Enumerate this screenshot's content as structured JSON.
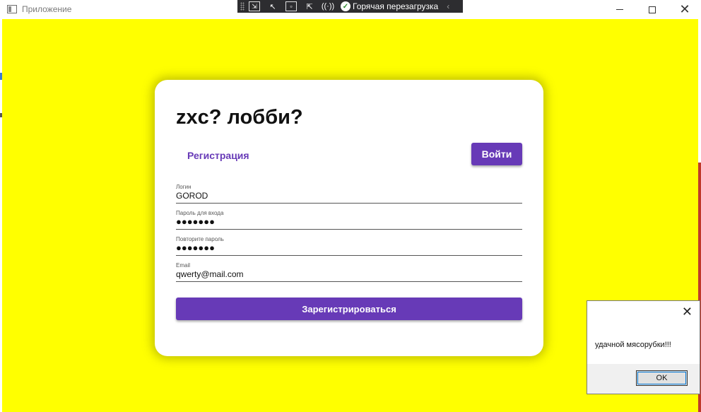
{
  "window": {
    "title": "Приложение"
  },
  "debug_toolbar": {
    "hot_reload_label": "Горячая перезагрузка"
  },
  "card": {
    "title": "zxc? лобби?",
    "register_tab": "Регистрация",
    "login_button": "Войти",
    "fields": [
      {
        "hint": "Логин",
        "value": "GOROD"
      },
      {
        "hint": "Пароль для входа",
        "value": "●●●●●●●"
      },
      {
        "hint": "Повторите пароль",
        "value": "●●●●●●●"
      },
      {
        "hint": "Email",
        "value": "qwerty@mail.com"
      }
    ],
    "submit_button": "Зарегистрироваться"
  },
  "message_box": {
    "text": "удачной мясорубки!!!",
    "ok_button": "OK"
  },
  "colors": {
    "background": "#ffff00",
    "accent": "#673ab7",
    "card": "#ffffff"
  }
}
